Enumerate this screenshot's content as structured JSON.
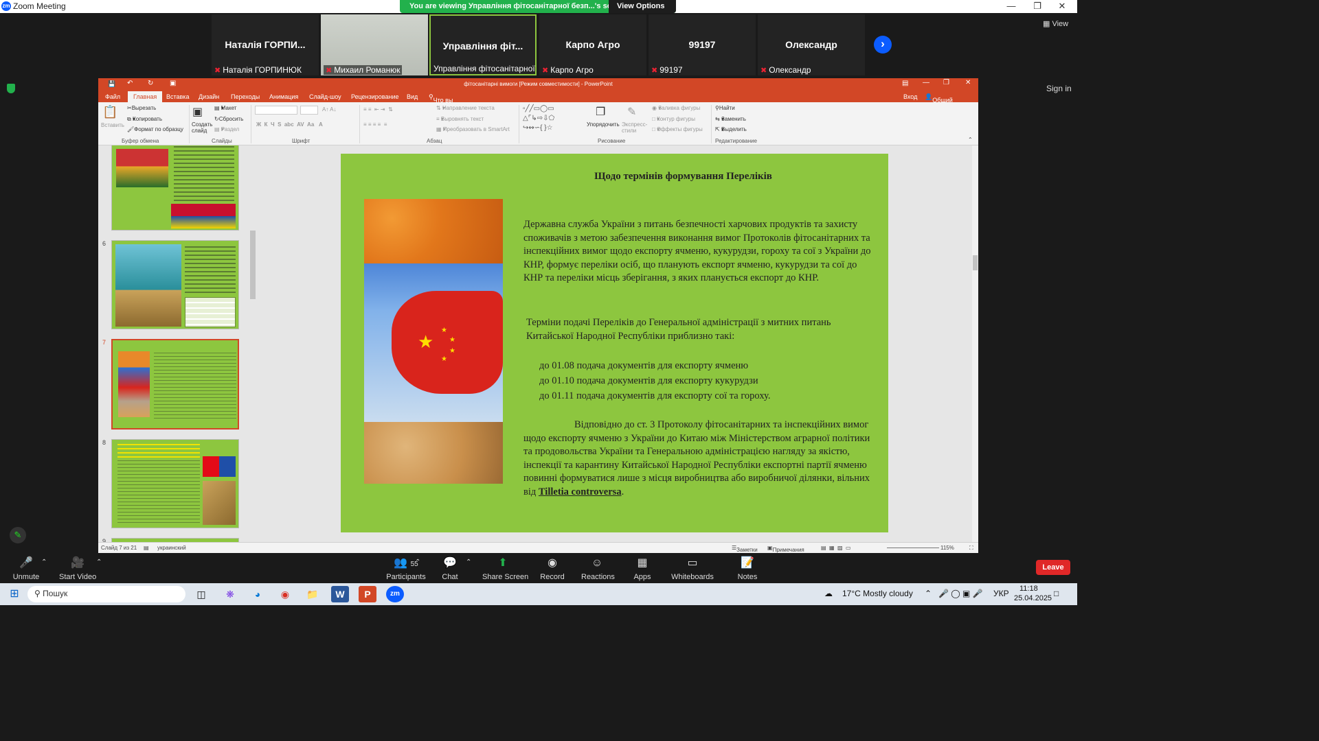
{
  "app": {
    "title": "Zoom Meeting"
  },
  "banner": {
    "message": "You are viewing Управління фітосанітарної безп...'s screen",
    "view_options": "View Options"
  },
  "participants_strip": [
    {
      "name": "Наталія ГОРПИ...",
      "label": "Наталія ГОРПИНЮК"
    },
    {
      "name": "",
      "label": "Михаил Романюк"
    },
    {
      "name": "Управління фіт...",
      "label": "Управління фітосанітарної бе..."
    },
    {
      "name": "Карпо Агро",
      "label": "Карпо Агро"
    },
    {
      "name": "99197",
      "label": "99197"
    },
    {
      "name": "Олександр",
      "label": "Олександр"
    }
  ],
  "top_right": {
    "view": "View",
    "sign_in": "Sign in"
  },
  "ppt": {
    "title": "фітосанітарні вимоги [Режим совместимости] - PowerPoint",
    "login": "Вход",
    "share": "Общий доступ",
    "tabs": [
      "Файл",
      "Главная",
      "Вставка",
      "Дизайн",
      "Переходы",
      "Анимация",
      "Слайд-шоу",
      "Рецензирование",
      "Вид",
      "Что вы хотите сделать?"
    ],
    "ribbon": {
      "paste": "Вставить",
      "cut": "Вырезать",
      "copy": "Копировать",
      "format_painter": "Формат по образцу",
      "layout": "Макет",
      "reset": "Сбросить",
      "section": "Раздел",
      "new_slide": "Создать слайд",
      "text_direction": "Направление текста",
      "align_text": "Выровнять текст",
      "smartart": "Преобразовать в SmartArt",
      "arrange": "Упорядочить",
      "quick_styles": "Экспресс-стили",
      "shape_fill": "Заливка фигуры",
      "shape_outline": "Контур фигуры",
      "shape_effects": "Эффекты фигуры",
      "find": "Найти",
      "replace": "Заменить",
      "select": "Выделить",
      "groups": [
        "Буфер обмена",
        "Слайды",
        "Шрифт",
        "Абзац",
        "Рисование",
        "Редактирование"
      ]
    },
    "thumb_numbers": [
      "6",
      "7",
      "8",
      "9"
    ],
    "slide": {
      "title": "Щодо термінів формування Переліків",
      "para1": "Державна служба України з питань безпечності харчових продуктів та захисту споживачів з метою забезпечення виконання вимог Протоколів фітосанітарних та інспекційних вимог щодо експорту ячменю, кукурудзи, гороху та сої з України до КНР, формує переліки осіб, що планують експорт ячменю, кукурудзи та сої до КНР та переліки місць зберігання, з яких планується експорт до КНР.",
      "para2": "Терміни подачі Переліків до Генеральної адміністрації з митних питань Китайської Народної Республіки приблизно такі:",
      "dates": [
        "до 01.08  подача документів для експорту ячменю",
        "до 01.10  подача документів для експорту кукурудзи",
        "до 01.11  подача документів для експорту сої та гороху."
      ],
      "para3a": "Відповідно до ст. 3 Протоколу фітосанітарних та інспекційних вимог щодо експорту ячменю з України до Китаю між Міністерством аграрної політики та продовольства України та Генеральною адміністрацією нагляду за якістю, інспекції та карантину Китайської Народної Республіки експортні партії ячменю повинні формуватися лише з місця виробництва або виробничої ділянки, вільних від ",
      "para3b": "Tilletia controversa",
      "para3c": "."
    },
    "status": {
      "slide": "Слайд 7 из 21",
      "lang": "украинский",
      "notes": "Заметки",
      "comments": "Примечания",
      "zoom": "115%"
    }
  },
  "toolbar": {
    "unmute": "Unmute",
    "start_video": "Start Video",
    "participants": "Participants",
    "participants_count": "55",
    "chat": "Chat",
    "share_screen": "Share Screen",
    "record": "Record",
    "reactions": "Reactions",
    "apps": "Apps",
    "whiteboards": "Whiteboards",
    "notes": "Notes",
    "leave": "Leave"
  },
  "taskbar": {
    "search": "Пошук",
    "weather": "17°C  Mostly cloudy",
    "lang": "УКР",
    "time": "11:18",
    "date": "25.04.2025"
  },
  "colors": {
    "slide_bg": "#8dc63f",
    "ppt_accent": "#d24726",
    "share_green": "#22b14c",
    "leave_red": "#e02828",
    "zoom_blue": "#0b5cff"
  }
}
